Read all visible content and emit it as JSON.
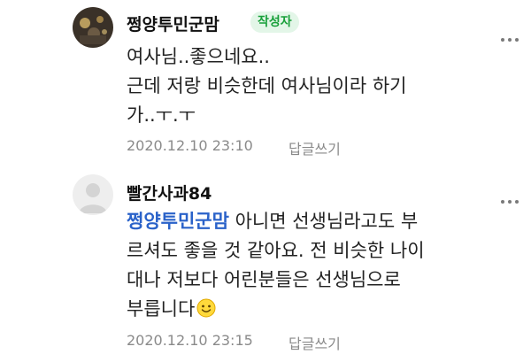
{
  "comments": [
    {
      "author": "쩡양투민군맘",
      "badge": "작성자",
      "lines": [
        "여사님..좋으네요..",
        "근데 저랑 비슷한데 여사님이라 하기",
        "가..ㅜ.ㅜ"
      ],
      "timestamp": "2020.12.10 23:10",
      "reply_label": "답글쓰기"
    },
    {
      "author": "빨간사과84",
      "mention": "쩡양투민군맘",
      "line1_rest": " 아니면 선생님라고도 부",
      "lines": [
        "르셔도 좋을 것 같아요. 전 비슷한 나이",
        "대나 저보다 어린분들은 선생님으로",
        "부릅니다"
      ],
      "timestamp": "2020.12.10 23:15",
      "reply_label": "답글쓰기"
    }
  ],
  "icons": {
    "more": "more-vertical-dots-icon",
    "emoji": "smiley-face-emoji-icon",
    "default_avatar": "default-profile-icon"
  },
  "colors": {
    "mention": "#2a62c9",
    "badge_text": "#18a03a",
    "badge_bg": "#e3f6e8",
    "meta": "#8a8a8a"
  }
}
